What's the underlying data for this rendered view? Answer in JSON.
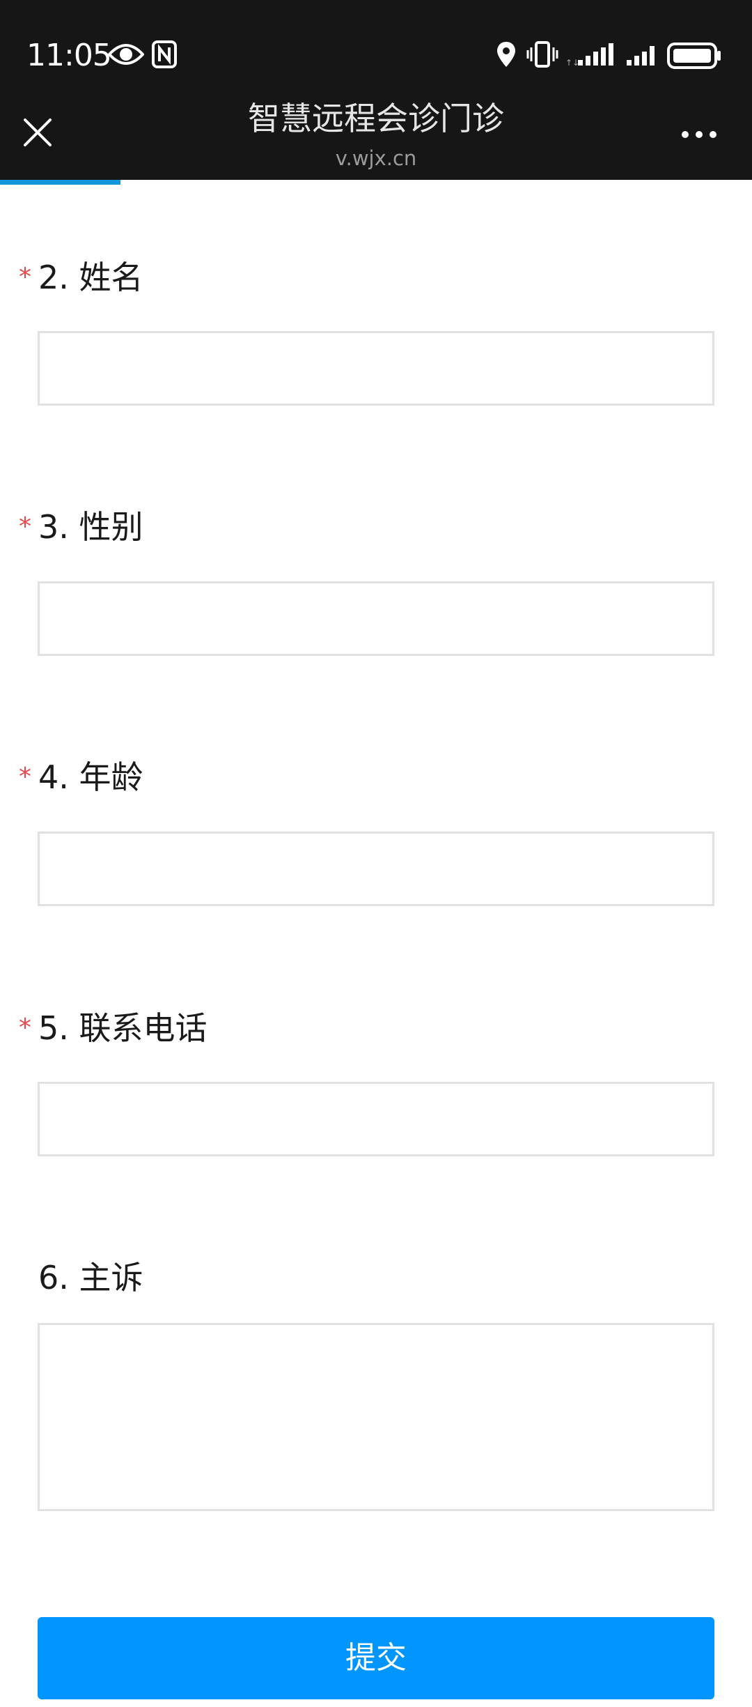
{
  "status_bar": {
    "time": "11:05",
    "icons": [
      "eye-icon",
      "nfc-icon",
      "location-icon",
      "vibrate-icon",
      "signal-icon",
      "signal-icon",
      "battery-icon"
    ]
  },
  "header": {
    "title": "智慧远程会诊门诊",
    "url": "v.wjx.cn",
    "close_icon": "close-icon",
    "more_icon": "more-icon"
  },
  "progress": {
    "fraction": 0.16
  },
  "colors": {
    "topbar_bg": "#161616",
    "accent": "#0095ff",
    "progress": "#1296db",
    "required": "#e84848",
    "input_border": "#e1e1e1"
  },
  "questions": [
    {
      "label": "2. 姓名",
      "required_mark": "*",
      "value": ""
    },
    {
      "label": "3. 性别",
      "required_mark": "*",
      "value": ""
    },
    {
      "label": "4. 年龄",
      "required_mark": "*",
      "value": ""
    },
    {
      "label": "5. 联系电话",
      "required_mark": "*",
      "value": ""
    },
    {
      "label": "6. 主诉",
      "value": ""
    }
  ],
  "submit_label": "提交"
}
